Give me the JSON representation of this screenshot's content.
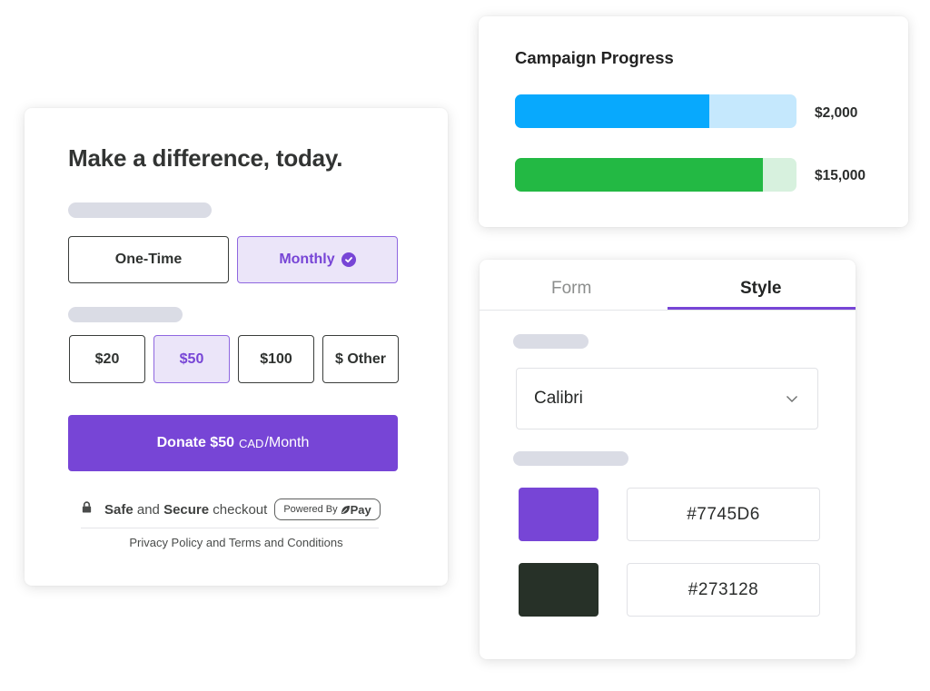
{
  "donation_form": {
    "title": "Make a difference, today.",
    "frequency_options": [
      {
        "label": "One-Time",
        "selected": false
      },
      {
        "label": "Monthly",
        "selected": true,
        "icon": "check-circle-icon"
      }
    ],
    "amount_options": [
      {
        "label": "$20",
        "selected": false
      },
      {
        "label": "$50",
        "selected": true
      },
      {
        "label": "$100",
        "selected": false
      },
      {
        "label": "$ Other",
        "selected": false
      }
    ],
    "donate_button": {
      "prefix": "Donate $50",
      "currency": "CAD",
      "period": "/Month"
    },
    "secure": {
      "icon": "lock-icon",
      "word1": "Safe",
      "word2": " and ",
      "word3": "Secure",
      "word4": " checkout"
    },
    "powered_by": {
      "label": "Powered By",
      "brand": "Pay",
      "brand_icon": "leaf-logo-icon"
    },
    "footer_link": "Privacy Policy and Terms and Conditions",
    "accent_color": "#7745D6"
  },
  "campaign_progress": {
    "title": "Campaign Progress",
    "bars": [
      {
        "label": "$2,000",
        "progress_percent": 69,
        "fill_color": "#08A9FD",
        "track_color": "#C5E8FD"
      },
      {
        "label": "$15,000",
        "progress_percent": 88,
        "fill_color": "#23B944",
        "track_color": "#D7F1DE"
      }
    ]
  },
  "style_panel": {
    "tabs": [
      {
        "label": "Form",
        "active": false
      },
      {
        "label": "Style",
        "active": true
      }
    ],
    "font_select": {
      "value": "Calibri",
      "icon": "chevron-down-icon"
    },
    "colors": [
      {
        "swatch": "#7745D6",
        "hex": "#7745D6"
      },
      {
        "swatch": "#273128",
        "hex": "#273128"
      }
    ]
  }
}
